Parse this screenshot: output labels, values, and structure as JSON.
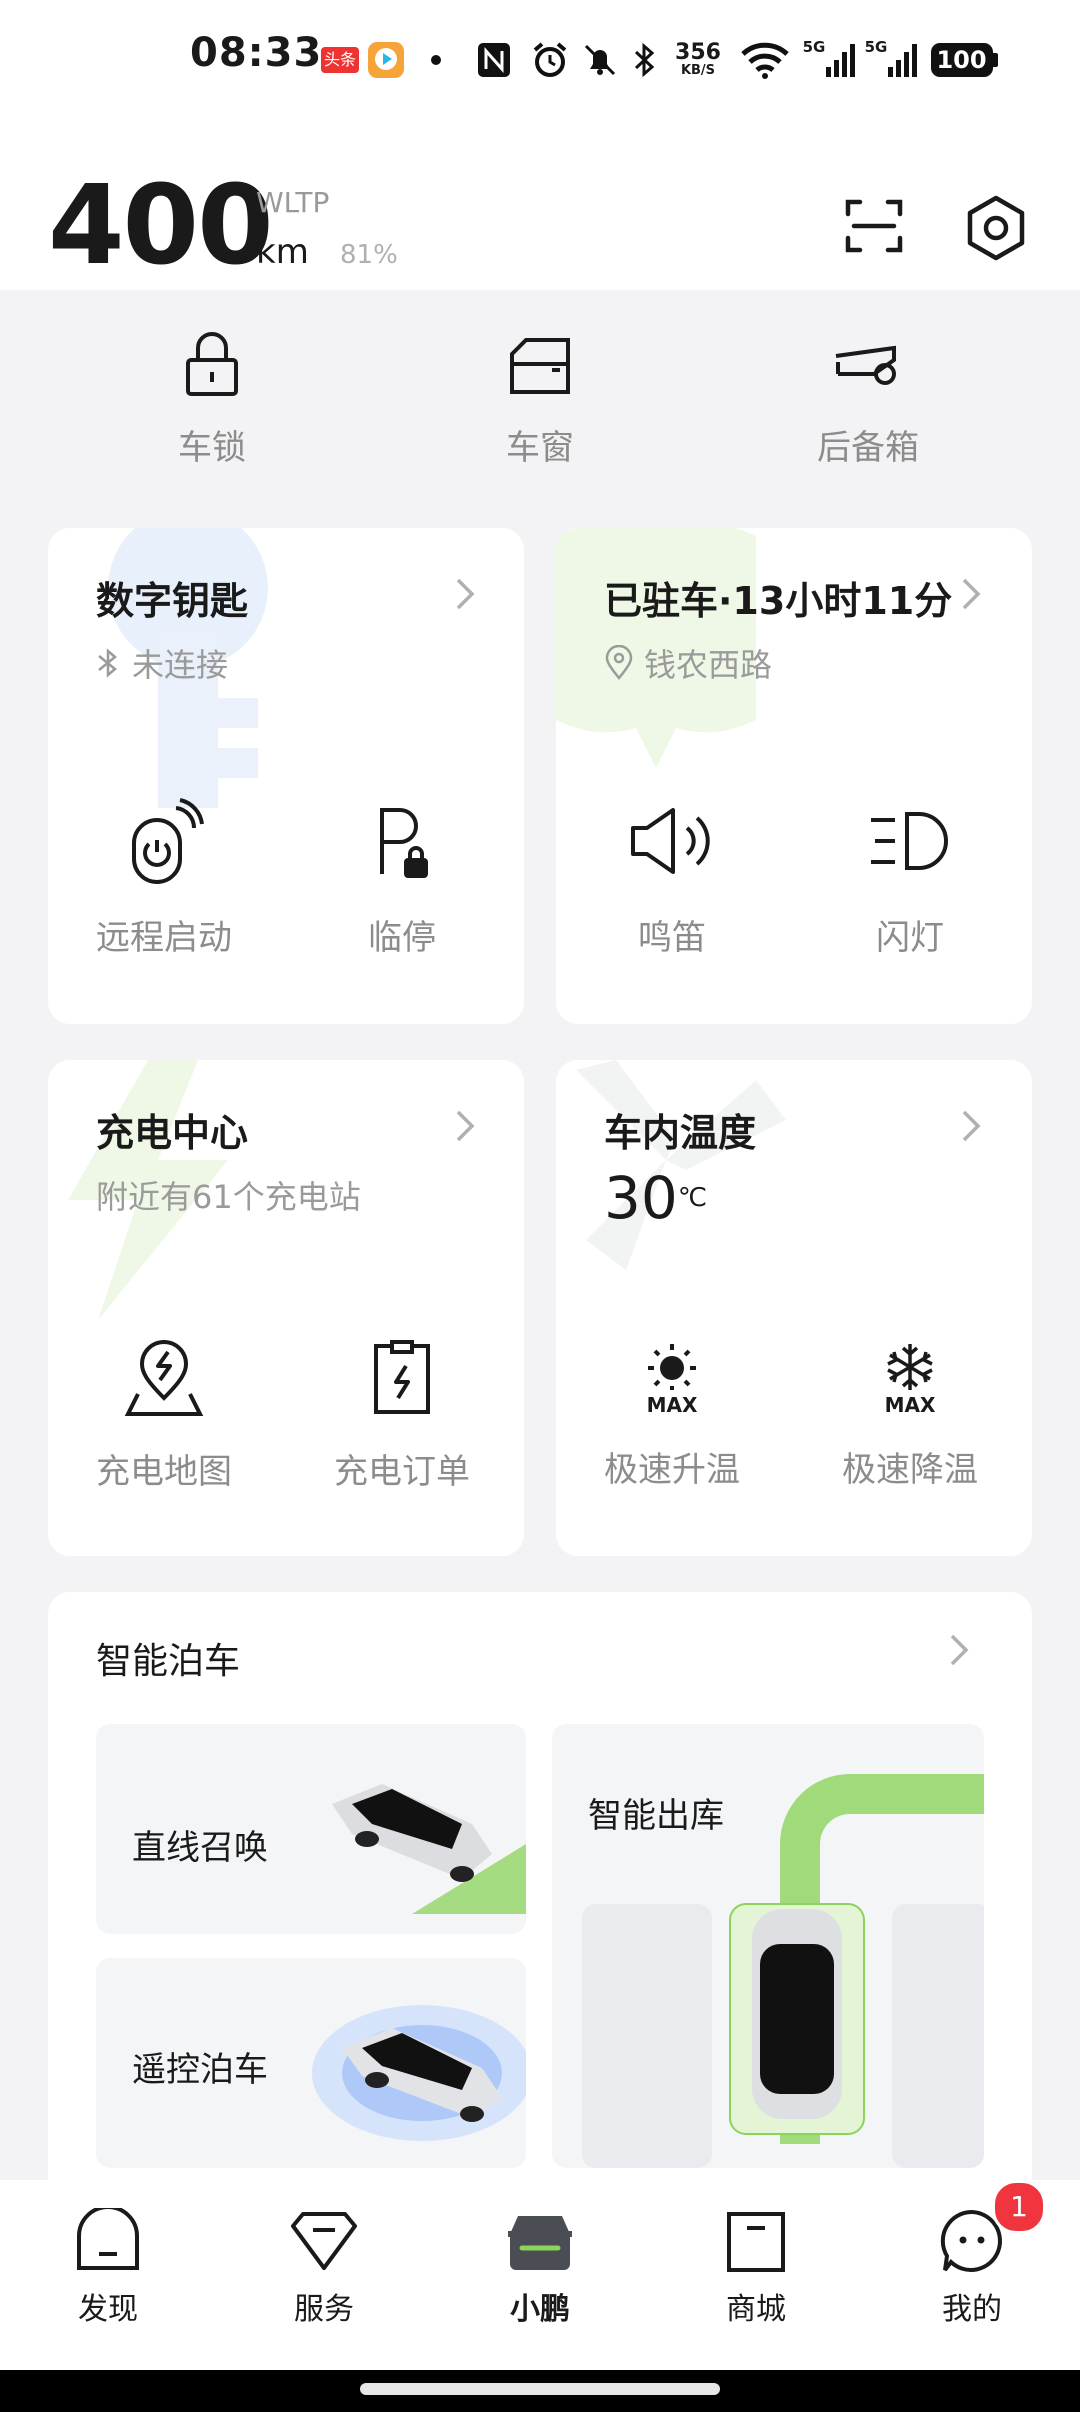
{
  "status_bar": {
    "time": "08:33",
    "app_badge": "头条",
    "net_speed": "356",
    "net_unit": "KB/S",
    "signal1": "5G",
    "signal2": "5G",
    "battery": "100",
    "icons": [
      "nfc-icon",
      "alarm-icon",
      "mute-icon",
      "bluetooth-icon",
      "wifi-icon",
      "signal-icon",
      "battery-icon"
    ]
  },
  "range": {
    "value": "400",
    "standard": "WLTP",
    "unit": "km",
    "battery_percent": "81%"
  },
  "header_icons": [
    "scan-icon",
    "settings-icon"
  ],
  "quick_controls": [
    {
      "label": "车锁",
      "icon": "lock-icon"
    },
    {
      "label": "车窗",
      "icon": "window-icon"
    },
    {
      "label": "后备箱",
      "icon": "trunk-icon"
    }
  ],
  "cards": {
    "digital_key": {
      "title": "数字钥匙",
      "status": "未连接",
      "actions": [
        {
          "label": "远程启动",
          "icon": "remote-start-icon"
        },
        {
          "label": "临停",
          "icon": "temp-parking-icon"
        }
      ]
    },
    "parked": {
      "title": "已驻车·13小时11分",
      "location": "钱农西路",
      "actions": [
        {
          "label": "鸣笛",
          "icon": "horn-icon"
        },
        {
          "label": "闪灯",
          "icon": "flash-light-icon"
        }
      ]
    },
    "charging": {
      "title": "充电中心",
      "subtitle": "附近有61个充电站",
      "actions": [
        {
          "label": "充电地图",
          "icon": "charge-map-icon"
        },
        {
          "label": "充电订单",
          "icon": "charge-order-icon"
        }
      ]
    },
    "temperature": {
      "title": "车内温度",
      "value": "30",
      "unit": "℃",
      "actions": [
        {
          "label": "极速升温",
          "icon": "max-heat-icon",
          "badge": "MAX"
        },
        {
          "label": "极速降温",
          "icon": "max-cool-icon",
          "badge": "MAX"
        }
      ]
    },
    "smart_parking": {
      "title": "智能泊车",
      "tiles": [
        {
          "label": "直线召唤"
        },
        {
          "label": "遥控泊车"
        },
        {
          "label": "智能出库"
        }
      ]
    }
  },
  "bottom_nav": {
    "items": [
      {
        "label": "发现",
        "icon": "discover-icon",
        "active": false
      },
      {
        "label": "服务",
        "icon": "service-icon",
        "active": false
      },
      {
        "label": "小鹏",
        "icon": "car-icon",
        "active": true
      },
      {
        "label": "商城",
        "icon": "shop-icon",
        "active": false
      },
      {
        "label": "我的",
        "icon": "profile-icon",
        "active": false,
        "badge": "1"
      }
    ]
  },
  "colors": {
    "accent_green": "#8bd35b",
    "badge_red": "#f0353f",
    "text_gray": "#8c8c8c"
  }
}
